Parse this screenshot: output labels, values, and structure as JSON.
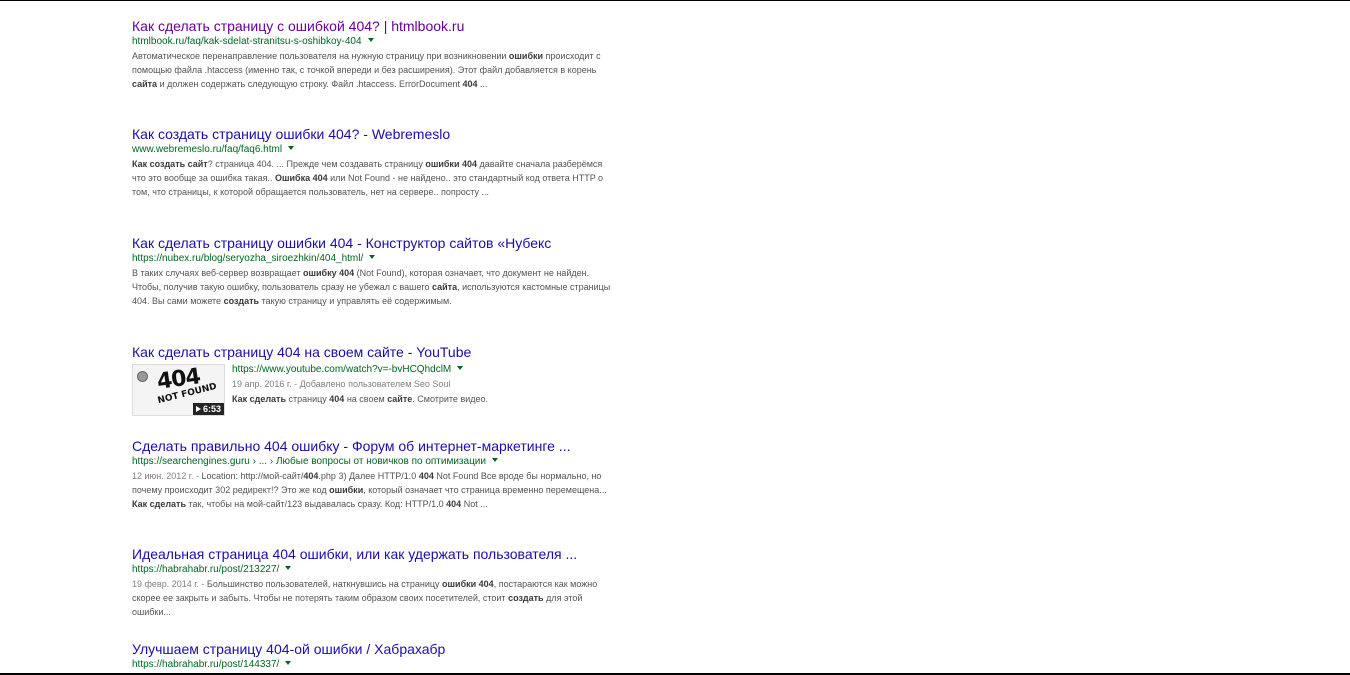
{
  "results": [
    {
      "title": "Как сделать страницу с ошибкой 404? | htmlbook.ru",
      "url": "htmlbook.ru/faq/kak-sdelat-stranitsu-s-oshibkoy-404",
      "snippet": [
        {
          "t": "Автоматическое перенаправление пользователя на нужную страницу при возникновении "
        },
        {
          "t": "ошибки",
          "b": true
        },
        {
          "t": " происходит с помощью файла .htaccess (именно так, с точкой впереди и без расширения). Этот файл добавляется в корень "
        },
        {
          "t": "сайта",
          "b": true
        },
        {
          "t": " и должен содержать следующую строку. Файл .htaccess. ErrorDocument "
        },
        {
          "t": "404",
          "b": true
        },
        {
          "t": " ..."
        }
      ]
    },
    {
      "title": "Как создать страницу ошибки 404? - Webremeslo",
      "url": "www.webremeslo.ru/faq/faq6.html",
      "snippet": [
        {
          "t": "Как создать сайт",
          "b": true
        },
        {
          "t": "? страница 404. ... Прежде чем создавать страницу "
        },
        {
          "t": "ошибки 404",
          "b": true
        },
        {
          "t": " давайте сначала разберёмся что это вообще за ошибка такая.. "
        },
        {
          "t": "Ошибка 404",
          "b": true
        },
        {
          "t": " или Not Found - не найдено.. это стандартный код ответа HTTP о том, что страницы, к которой обращается пользователь, нет на сервере.. попросту ..."
        }
      ]
    },
    {
      "title": "Как сделать страницу ошибки 404 - Конструктор сайтов «Нубекс",
      "url": "https://nubex.ru/blog/seryozha_siroezhkin/404_html/",
      "snippet": [
        {
          "t": "В таких случаях веб-сервер возвращает "
        },
        {
          "t": "ошибку 404",
          "b": true
        },
        {
          "t": " (Not Found), которая означает, что документ не найден. Чтобы, получив такую ошибку, пользователь сразу не убежал с вашего "
        },
        {
          "t": "сайта",
          "b": true
        },
        {
          "t": ", используются кастомные страницы 404. Вы сами можете "
        },
        {
          "t": "создать",
          "b": true
        },
        {
          "t": " такую страницу и управлять её содержимым."
        }
      ]
    },
    {
      "title": "Как сделать страницу 404 на своем сайте - YouTube",
      "url": "https://www.youtube.com/watch?v=-bvHCQhdclM",
      "meta": "19 апр. 2016 г. - Добавлено пользователем Seo Soul",
      "duration": "6:53",
      "thumb_text_big": "404",
      "thumb_text_small": "NOT FOUND",
      "snippet": [
        {
          "t": "Как сделать",
          "b": true
        },
        {
          "t": " страницу "
        },
        {
          "t": "404",
          "b": true
        },
        {
          "t": " на своем "
        },
        {
          "t": "сайте",
          "b": true
        },
        {
          "t": ". Смотрите видео."
        }
      ]
    },
    {
      "title": "Сделать правильно 404 ошибку - Форум об интернет-маркетинге ...",
      "url": "https://searchengines.guru › ... › Любые вопросы от новичков по оптимизации",
      "snippet": [
        {
          "t": "12 июн. 2012 г. - ",
          "m": true
        },
        {
          "t": "Location: http://мой-сайт/"
        },
        {
          "t": "404",
          "b": true
        },
        {
          "t": ".php 3) Далее HTTP/1.0 "
        },
        {
          "t": "404",
          "b": true
        },
        {
          "t": " Not Found Все вроде бы нормально, но почему происходит 302 редирект!? Это же код "
        },
        {
          "t": "ошибки",
          "b": true
        },
        {
          "t": ", который означает что страница временно перемещена... "
        },
        {
          "t": "Как сделать",
          "b": true
        },
        {
          "t": " так, чтобы на мой-сайт/123 выдавалась сразу. Код: HTTP/1.0 "
        },
        {
          "t": "404",
          "b": true
        },
        {
          "t": " Not ..."
        }
      ]
    },
    {
      "title": "Идеальная страница 404 ошибки, или как удержать пользователя ...",
      "url": "https://habrahabr.ru/post/213227/",
      "snippet": [
        {
          "t": "19 февр. 2014 г. - ",
          "m": true
        },
        {
          "t": "Большинство пользователей, наткнувшись на страницу "
        },
        {
          "t": "ошибки 404",
          "b": true
        },
        {
          "t": ", постараются как можно скорее ее закрыть и забыть. Чтобы не потерять таким образом своих посетителей, стоит "
        },
        {
          "t": "создать",
          "b": true
        },
        {
          "t": " для этой ошибки..."
        }
      ]
    },
    {
      "title": "Улучшаем страницу 404-ой ошибки / Хабрахабр",
      "url": "https://habrahabr.ru/post/144337/",
      "snippet": []
    }
  ]
}
